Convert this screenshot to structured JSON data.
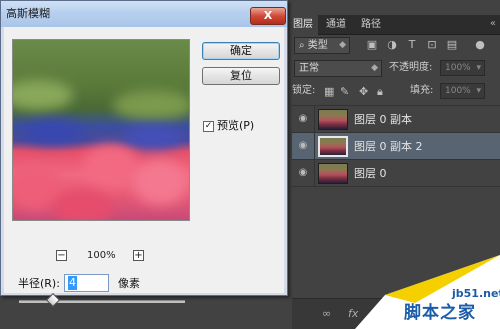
{
  "dialog": {
    "title": "高斯模糊",
    "close_label": "X",
    "ok_label": "确定",
    "reset_label": "复位",
    "preview_checkbox": {
      "label": "预览(P)",
      "checked": true,
      "mark": "✓"
    },
    "zoom": {
      "minus": "−",
      "value": "100%",
      "plus": "+"
    },
    "radius": {
      "label": "半径(R):",
      "value": "4",
      "unit": "像素"
    }
  },
  "layers_panel": {
    "tabs": [
      "图层",
      "通道",
      "路径"
    ],
    "filter_kind": "类型",
    "blend_mode": "正常",
    "opacity": {
      "label": "不透明度:",
      "value": "100%"
    },
    "lock_label": "锁定:",
    "fill": {
      "label": "填充:",
      "value": "100%"
    },
    "layers": [
      {
        "name": "图层 0 副本",
        "selected": false
      },
      {
        "name": "图层 0 副本 2",
        "selected": true
      },
      {
        "name": "图层 0",
        "selected": false
      }
    ],
    "bottom_icons": [
      "link-icon",
      "fx-icon"
    ],
    "bottom_fx_label": "fx"
  },
  "watermark": {
    "site": "jb51.net",
    "name": "脚本之家"
  },
  "colors": {
    "selected_layer": "#596472",
    "panel_bg": "#424242",
    "watermark_blue": "#1b5ca8",
    "dialog_title_gradient_top": "#cfe1f6",
    "close_button_red": "#d04a36"
  }
}
